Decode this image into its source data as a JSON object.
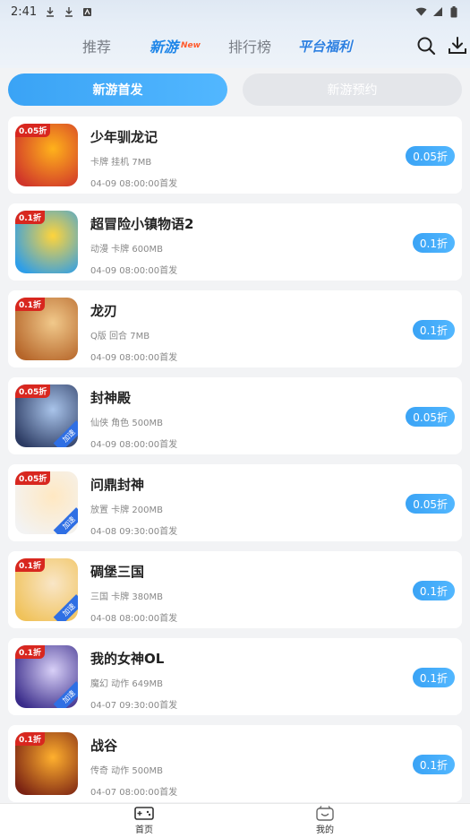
{
  "status": {
    "time": "2:41"
  },
  "tabs": {
    "recommend": "推荐",
    "newgame": "新游",
    "newgame_badge": "New",
    "ranking": "排行榜",
    "platform": "平台福利"
  },
  "segments": {
    "first": "新游首发",
    "reserve": "新游预约"
  },
  "games": [
    {
      "name": "少年驯龙记",
      "tags": "卡牌 挂机 7MB",
      "date": "04-09 08:00:00首发",
      "discount": "0.05折",
      "badge": "0.05折",
      "colors": [
        "#d0352a",
        "#ffb21b"
      ]
    },
    {
      "name": "超冒险小镇物语2",
      "tags": "动漫 卡牌 600MB",
      "date": "04-09 08:00:00首发",
      "discount": "0.1折",
      "badge": "0.1折",
      "colors": [
        "#2e9ee8",
        "#ffd43b"
      ]
    },
    {
      "name": "龙刃",
      "tags": "Q版 回合 7MB",
      "date": "04-09 08:00:00首发",
      "discount": "0.1折",
      "badge": "0.1折",
      "colors": [
        "#b6662a",
        "#f1c98b"
      ]
    },
    {
      "name": "封神殿",
      "tags": "仙侠 角色 500MB",
      "date": "04-09 08:00:00首发",
      "discount": "0.05折",
      "badge": "0.05折",
      "colors": [
        "#2c3b63",
        "#a9c4ea"
      ]
    },
    {
      "name": "问鼎封神",
      "tags": "放置 卡牌 200MB",
      "date": "04-08 09:30:00首发",
      "discount": "0.05折",
      "badge": "0.05折",
      "colors": [
        "#f3f3f3",
        "#ffe8c2"
      ]
    },
    {
      "name": "碉堡三国",
      "tags": "三国 卡牌 380MB",
      "date": "04-08 08:00:00首发",
      "discount": "0.1折",
      "badge": "0.1折",
      "colors": [
        "#f0c25a",
        "#f9e6c7"
      ]
    },
    {
      "name": "我的女神OL",
      "tags": "魔幻 动作 649MB",
      "date": "04-07 09:30:00首发",
      "discount": "0.1折",
      "badge": "0.1折",
      "colors": [
        "#3a2c8a",
        "#d8d0f7"
      ]
    },
    {
      "name": "战谷",
      "tags": "传奇 动作 500MB",
      "date": "04-07 08:00:00首发",
      "discount": "0.1折",
      "badge": "0.1折",
      "colors": [
        "#7b2313",
        "#ffb02e"
      ]
    }
  ],
  "speed_label": "加速",
  "bottom_nav": {
    "home": "首页",
    "mine": "我的"
  },
  "accent": "#3aa3f5"
}
